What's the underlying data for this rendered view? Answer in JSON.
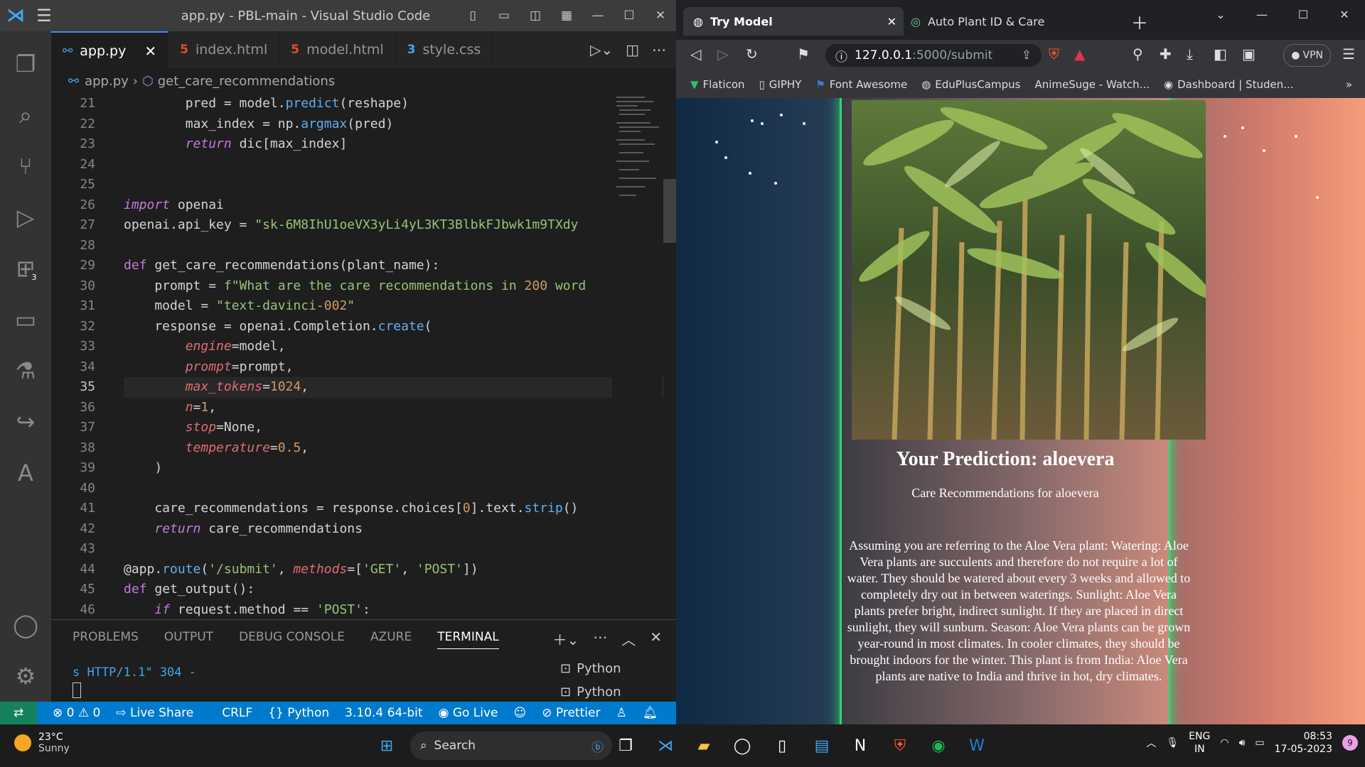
{
  "vscode": {
    "window_title": "app.py - PBL-main - Visual Studio Code",
    "tabs": [
      {
        "label": "app.py",
        "icon": "python-icon"
      },
      {
        "label": "index.html",
        "icon": "html5-icon"
      },
      {
        "label": "model.html",
        "icon": "html5-icon"
      },
      {
        "label": "style.css",
        "icon": "css3-icon"
      }
    ],
    "breadcrumb": {
      "file": "app.py",
      "symbol": "get_care_recommendations"
    },
    "activity_badge": "3",
    "line_numbers": [
      "21",
      "22",
      "23",
      "24",
      "25",
      "26",
      "27",
      "28",
      "29",
      "30",
      "31",
      "32",
      "33",
      "34",
      "35",
      "36",
      "37",
      "38",
      "39",
      "40",
      "41",
      "42",
      "43",
      "44",
      "45",
      "46"
    ],
    "code_lines": [
      "        pred = model.predict(reshape)",
      "        max_index = np.argmax(pred)",
      "        return dic[max_index]",
      "",
      "",
      "import openai",
      "openai.api_key = \"sk-6M8IhU1oeVX3yLi4yL3KT3BlbkFJbwk1m9TXdy",
      "",
      "def get_care_recommendations(plant_name):",
      "    prompt = f\"What are the care recommendations in 200 word",
      "    model = \"text-davinci-002\"",
      "    response = openai.Completion.create(",
      "        engine=model,",
      "        prompt=prompt,",
      "        max_tokens=1024,",
      "        n=1,",
      "        stop=None,",
      "        temperature=0.5,",
      "    )",
      "",
      "    care_recommendations = response.choices[0].text.strip()",
      "    return care_recommendations",
      "",
      "@app.route('/submit', methods=['GET', 'POST'])",
      "def get_output():",
      "    if request.method == 'POST':"
    ],
    "panel": {
      "tabs": [
        "PROBLEMS",
        "OUTPUT",
        "DEBUG CONSOLE",
        "AZURE",
        "TERMINAL"
      ],
      "terminal_line": "s HTTP/1.1\" 304 -",
      "terminals": [
        "Python",
        "Python"
      ]
    },
    "status": {
      "errors": "0",
      "warnings": "0",
      "live_share": "Live Share",
      "eol": "CRLF",
      "language": "Python",
      "interpreter": "3.10.4 64-bit",
      "go_live": "Go Live",
      "prettier": "Prettier"
    }
  },
  "browser": {
    "tabs": [
      {
        "label": "Try Model",
        "active": true
      },
      {
        "label": "Auto Plant ID & Care",
        "active": false
      }
    ],
    "url": {
      "host": "127.0.0.1",
      "path": ":5000/submit"
    },
    "vpn": "VPN",
    "bookmarks": [
      "Flaticon",
      "GIPHY",
      "Font Awesome",
      "EduPlusCampus",
      "AnimeSuge - Watch...",
      "Dashboard | Studen..."
    ],
    "page": {
      "prediction": "Your Prediction: aloevera",
      "subheading": "Care Recommendations for aloevera",
      "care_text": "Assuming you are referring to the Aloe Vera plant: Watering: Aloe Vera plants are succulents and therefore do not require a lot of water. They should be watered about every 3 weeks and allowed to completely dry out in between waterings. Sunlight: Aloe Vera plants prefer bright, indirect sunlight. If they are placed in direct sunlight, they will sunburn. Season: Aloe Vera plants can be grown year-round in most climates. In cooler climates, they should be brought indoors for the winter. This plant is from India: Aloe Vera plants are native to India and thrive in hot, dry climates."
    }
  },
  "taskbar": {
    "weather_temp": "23°C",
    "weather_desc": "Sunny",
    "search_placeholder": "Search",
    "lang_top": "ENG",
    "lang_bottom": "IN",
    "time": "08:53",
    "date": "17-05-2023",
    "notifications": "9"
  },
  "colors": {
    "vscode_accent": "#007acc",
    "card_border": "#2ed573",
    "page_gradient_left": "#0f2a45",
    "page_gradient_right": "#f59c7a"
  }
}
